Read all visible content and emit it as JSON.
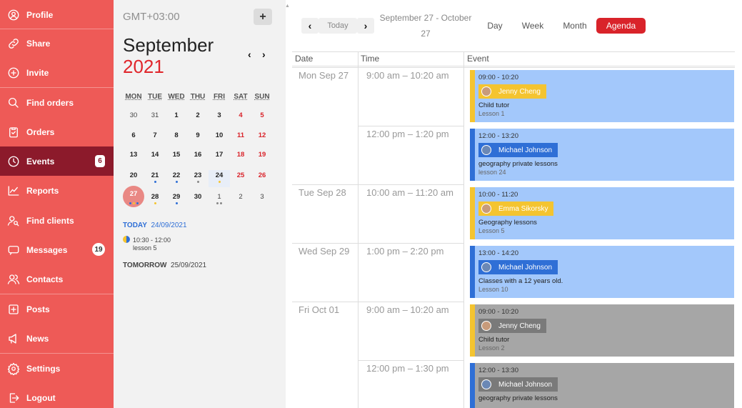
{
  "sidebar": {
    "items": [
      {
        "label": "Profile",
        "icon": "user-circle-icon"
      },
      {
        "label": "Share",
        "icon": "link-icon"
      },
      {
        "label": "Invite",
        "icon": "plus-circle-icon"
      },
      {
        "label": "Find orders",
        "icon": "search-icon"
      },
      {
        "label": "Orders",
        "icon": "clipboard-icon"
      },
      {
        "label": "Events",
        "icon": "clock-icon",
        "badge": "6"
      },
      {
        "label": "Reports",
        "icon": "chart-line-icon"
      },
      {
        "label": "Find clients",
        "icon": "user-search-icon"
      },
      {
        "label": "Messages",
        "icon": "chat-icon",
        "badge": "19"
      },
      {
        "label": "Contacts",
        "icon": "users-icon"
      },
      {
        "label": "Posts",
        "icon": "plus-square-icon"
      },
      {
        "label": "News",
        "icon": "megaphone-icon"
      },
      {
        "label": "Settings",
        "icon": "gear-icon"
      },
      {
        "label": "Logout",
        "icon": "logout-icon"
      }
    ]
  },
  "calendar": {
    "timezone": "GMT+03:00",
    "add_label": "+",
    "month": "September",
    "year": "2021",
    "prev": "‹",
    "next": "›",
    "weekdays": [
      "MON",
      "TUE",
      "WED",
      "THU",
      "FRI",
      "SAT",
      "SUN"
    ],
    "weeks": [
      [
        "30",
        "31",
        "1",
        "2",
        "3",
        "4",
        "5"
      ],
      [
        "6",
        "7",
        "8",
        "9",
        "10",
        "11",
        "12"
      ],
      [
        "13",
        "14",
        "15",
        "16",
        "17",
        "18",
        "19"
      ],
      [
        "20",
        "21",
        "22",
        "23",
        "24",
        "25",
        "26"
      ],
      [
        "27",
        "28",
        "29",
        "30",
        "1",
        "2",
        "3"
      ]
    ]
  },
  "agenda_preview": {
    "today_label": "TODAY",
    "today_date": "24/09/2021",
    "event_time": "10:30 - 12:00",
    "event_title": "lesson 5",
    "tomorrow_label": "TOMORROW",
    "tomorrow_date": "25/09/2021"
  },
  "toolbar": {
    "prev": "‹",
    "today": "Today",
    "next": "›",
    "range_line1": "September 27 - October",
    "range_line2": "27",
    "views": [
      "Day",
      "Week",
      "Month",
      "Agenda"
    ],
    "active_view": "Agenda"
  },
  "table": {
    "headers": [
      "Date",
      "Time",
      "Event"
    ],
    "rows": [
      {
        "date": "Mon Sep 27",
        "time": "9:00 am – 10:20 am",
        "ev_time": "09:00 - 10:20",
        "person": "Jenny Cheng",
        "title": "Child tutor",
        "sub": "Lesson 1"
      },
      {
        "date": "",
        "time": "12:00 pm – 1:20 pm",
        "ev_time": "12:00 - 13:20",
        "person": "Michael Johnson",
        "title": "geography private lessons",
        "sub": "lesson 24"
      },
      {
        "date": "Tue Sep 28",
        "time": "10:00 am – 11:20 am",
        "ev_time": "10:00 - 11:20",
        "person": "Emma Sikorsky",
        "title": "Geography lessons",
        "sub": "Lesson 5"
      },
      {
        "date": "Wed Sep 29",
        "time": "1:00 pm – 2:20 pm",
        "ev_time": "13:00 - 14:20",
        "person": "Michael Johnson",
        "title": "Classes with a 12 years old.",
        "sub": "Lesson 10"
      },
      {
        "date": "Fri Oct 01",
        "time": "9:00 am – 10:20 am",
        "ev_time": "09:00 - 10:20",
        "person": "Jenny Cheng",
        "title": "Child tutor",
        "sub": "Lesson 2"
      },
      {
        "date": "",
        "time": "12:00 pm – 1:30 pm",
        "ev_time": "12:00 - 13:30",
        "person": "Michael Johnson",
        "title": "geography private lessons",
        "sub": ""
      }
    ]
  },
  "colors": {
    "sidebar_bg": "#ee5a57",
    "sidebar_active": "#8c1a2b",
    "accent_red": "#d9232a",
    "event_blue": "#a3c8fb",
    "event_gray": "#a6a6a6",
    "tag_yellow": "#f4c430",
    "tag_blue": "#2f6fd6"
  }
}
